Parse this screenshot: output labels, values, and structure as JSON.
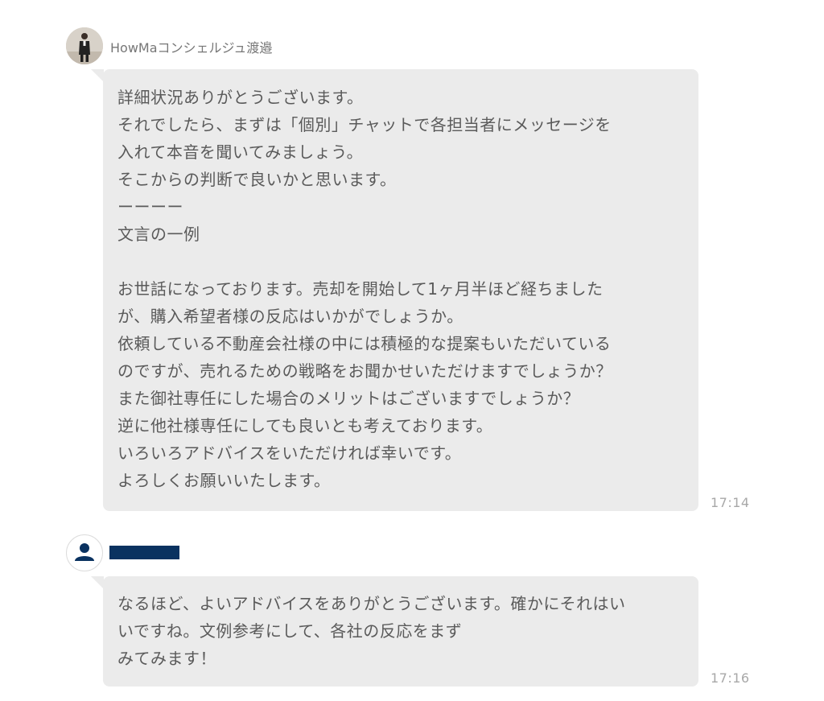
{
  "messages": [
    {
      "sender": "HowMaコンシェルジュ渡邉",
      "text": "詳細状況ありがとうございます。\nそれでしたら、まずは「個別」チャットで各担当者にメッセージを\n入れて本音を聞いてみましょう。\nそこからの判断で良いかと思います。\nーーーー\n文言の一例\n\nお世話になっております。売却を開始して1ヶ月半ほど経ちました\nが、購入希望者様の反応はいかがでしょうか。\n依頼している不動産会社様の中には積極的な提案もいただいている\nのですが、売れるための戦略をお聞かせいただけますでしょうか？\nまた御社専任にした場合のメリットはございますでしょうか？\n逆に他社様専任にしても良いとも考えております。\nいろいろアドバイスをいただければ幸いです。\nよろしくお願いいたします。",
      "time": "17:14"
    },
    {
      "sender": "",
      "text": "なるほど、よいアドバイスをありがとうございます。確かにそれはい\nいですね。文例参考にして、各社の反応をまず\nみてみます！",
      "time": "17:16"
    }
  ],
  "colors": {
    "bubble": "#ebebeb",
    "redacted_name": "#0a3260",
    "default_avatar": "#0a3260"
  }
}
